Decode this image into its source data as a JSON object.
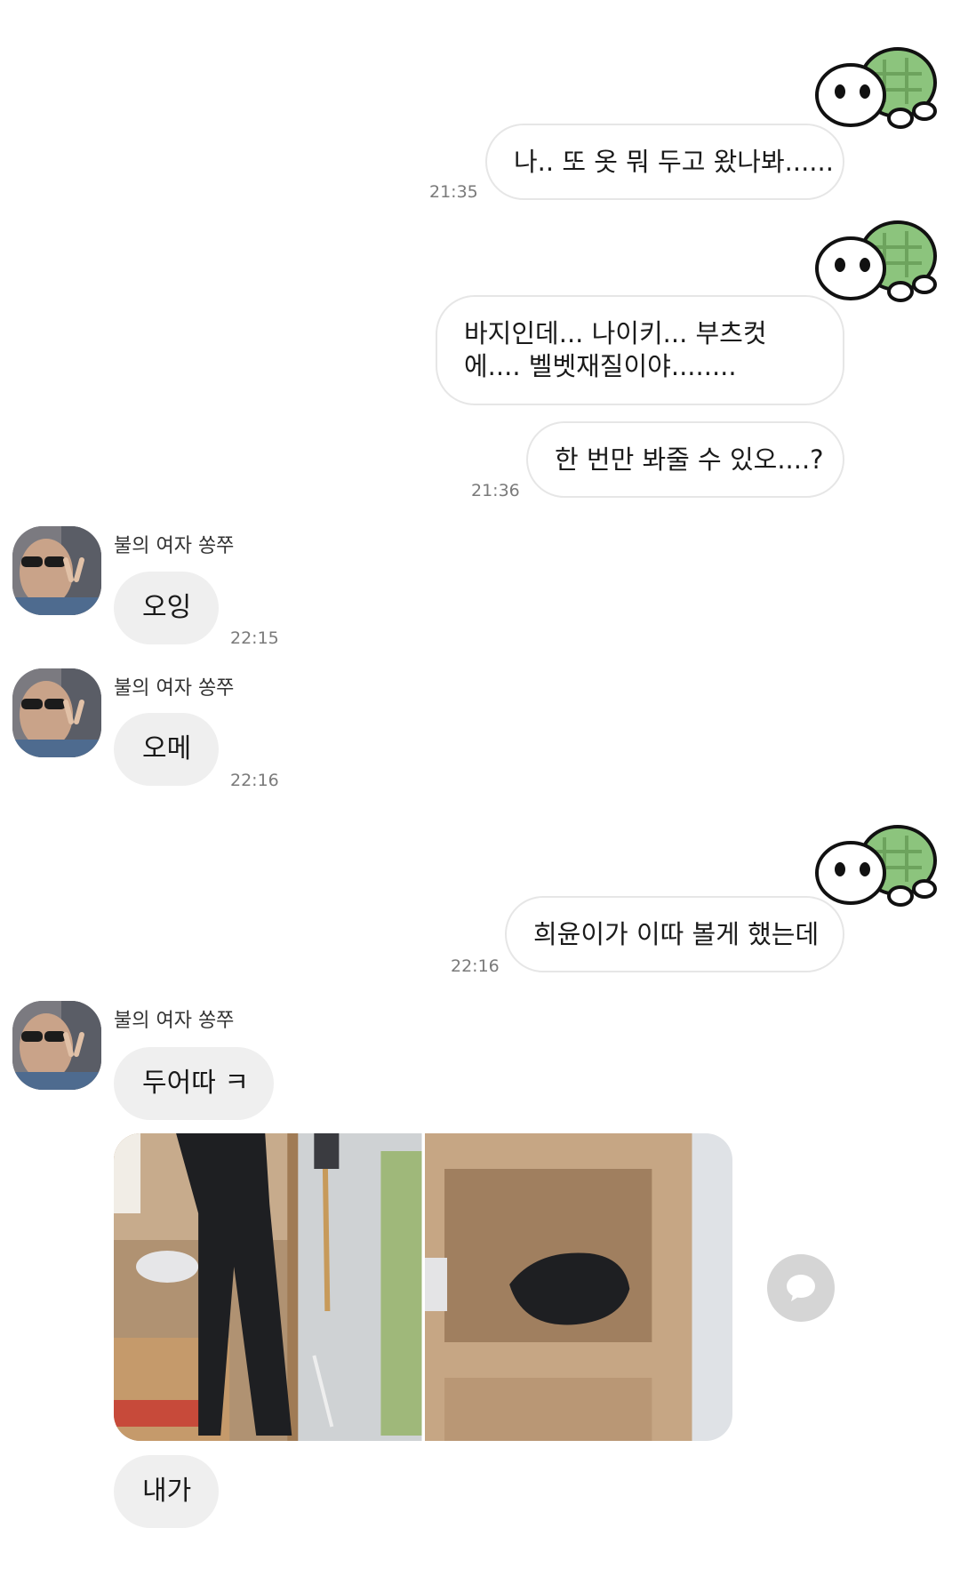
{
  "contact": {
    "name": "불의 여자 쏭쭈"
  },
  "colors": {
    "outgoing_bubble": "#ffffff",
    "incoming_bubble": "#efefef",
    "turtle_shell": "#8cc47d",
    "reply_button": "#d5d5d5"
  },
  "messages": [
    {
      "side": "out",
      "text": "나.. 또 옷 뭐 두고 왔나봐......",
      "time": "21:35"
    },
    {
      "side": "out",
      "text": "바지인데... 나이키... 부츠컷에.... 벨벳재질이야........"
    },
    {
      "side": "out",
      "text": "한 번만 봐줄 수 있오....?",
      "time": "21:36"
    },
    {
      "side": "in",
      "sender": "불의 여자 쏭쭈",
      "text": "오잉",
      "time": "22:15"
    },
    {
      "side": "in",
      "sender": "불의 여자 쏭쭈",
      "text": "오메",
      "time": "22:16"
    },
    {
      "side": "out",
      "text": "희윤이가 이따 볼게 했는데",
      "time": "22:16"
    },
    {
      "side": "in",
      "sender": "불의 여자 쏭쭈",
      "text": "두어따 ㅋ"
    },
    {
      "side": "in",
      "type": "photos",
      "count": 2
    },
    {
      "side": "in",
      "text": "내가"
    }
  ],
  "icons": {
    "outgoing_avatar": "turtle-sticker-icon",
    "reply": "speech-bubble-icon"
  }
}
